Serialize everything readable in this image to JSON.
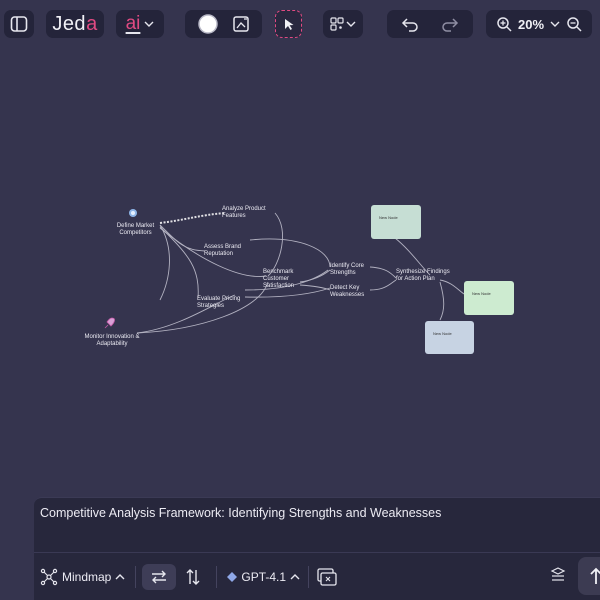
{
  "toolbar": {
    "brand": "Jeda",
    "ai_label": "ai",
    "zoom": "20%"
  },
  "mindmap": {
    "root": "Define Market Competitors",
    "branches": [
      "Analyze Product Features",
      "Assess Brand Reputation",
      "Benchmark Customer Satisfaction",
      "Evaluate Pricing Strategies",
      "Monitor Innovation & Adaptability",
      "Identify Core Strengths",
      "Detect Key Weaknesses",
      "Synthesize Findings for Action Plan"
    ],
    "notes": [
      "New Node",
      "New Node",
      "New Node"
    ]
  },
  "prompt": {
    "text": "Competitive Analysis Framework: Identifying Strengths and Weaknesses"
  },
  "bottom": {
    "mode": "Mindmap",
    "model": "GPT-4.1"
  }
}
